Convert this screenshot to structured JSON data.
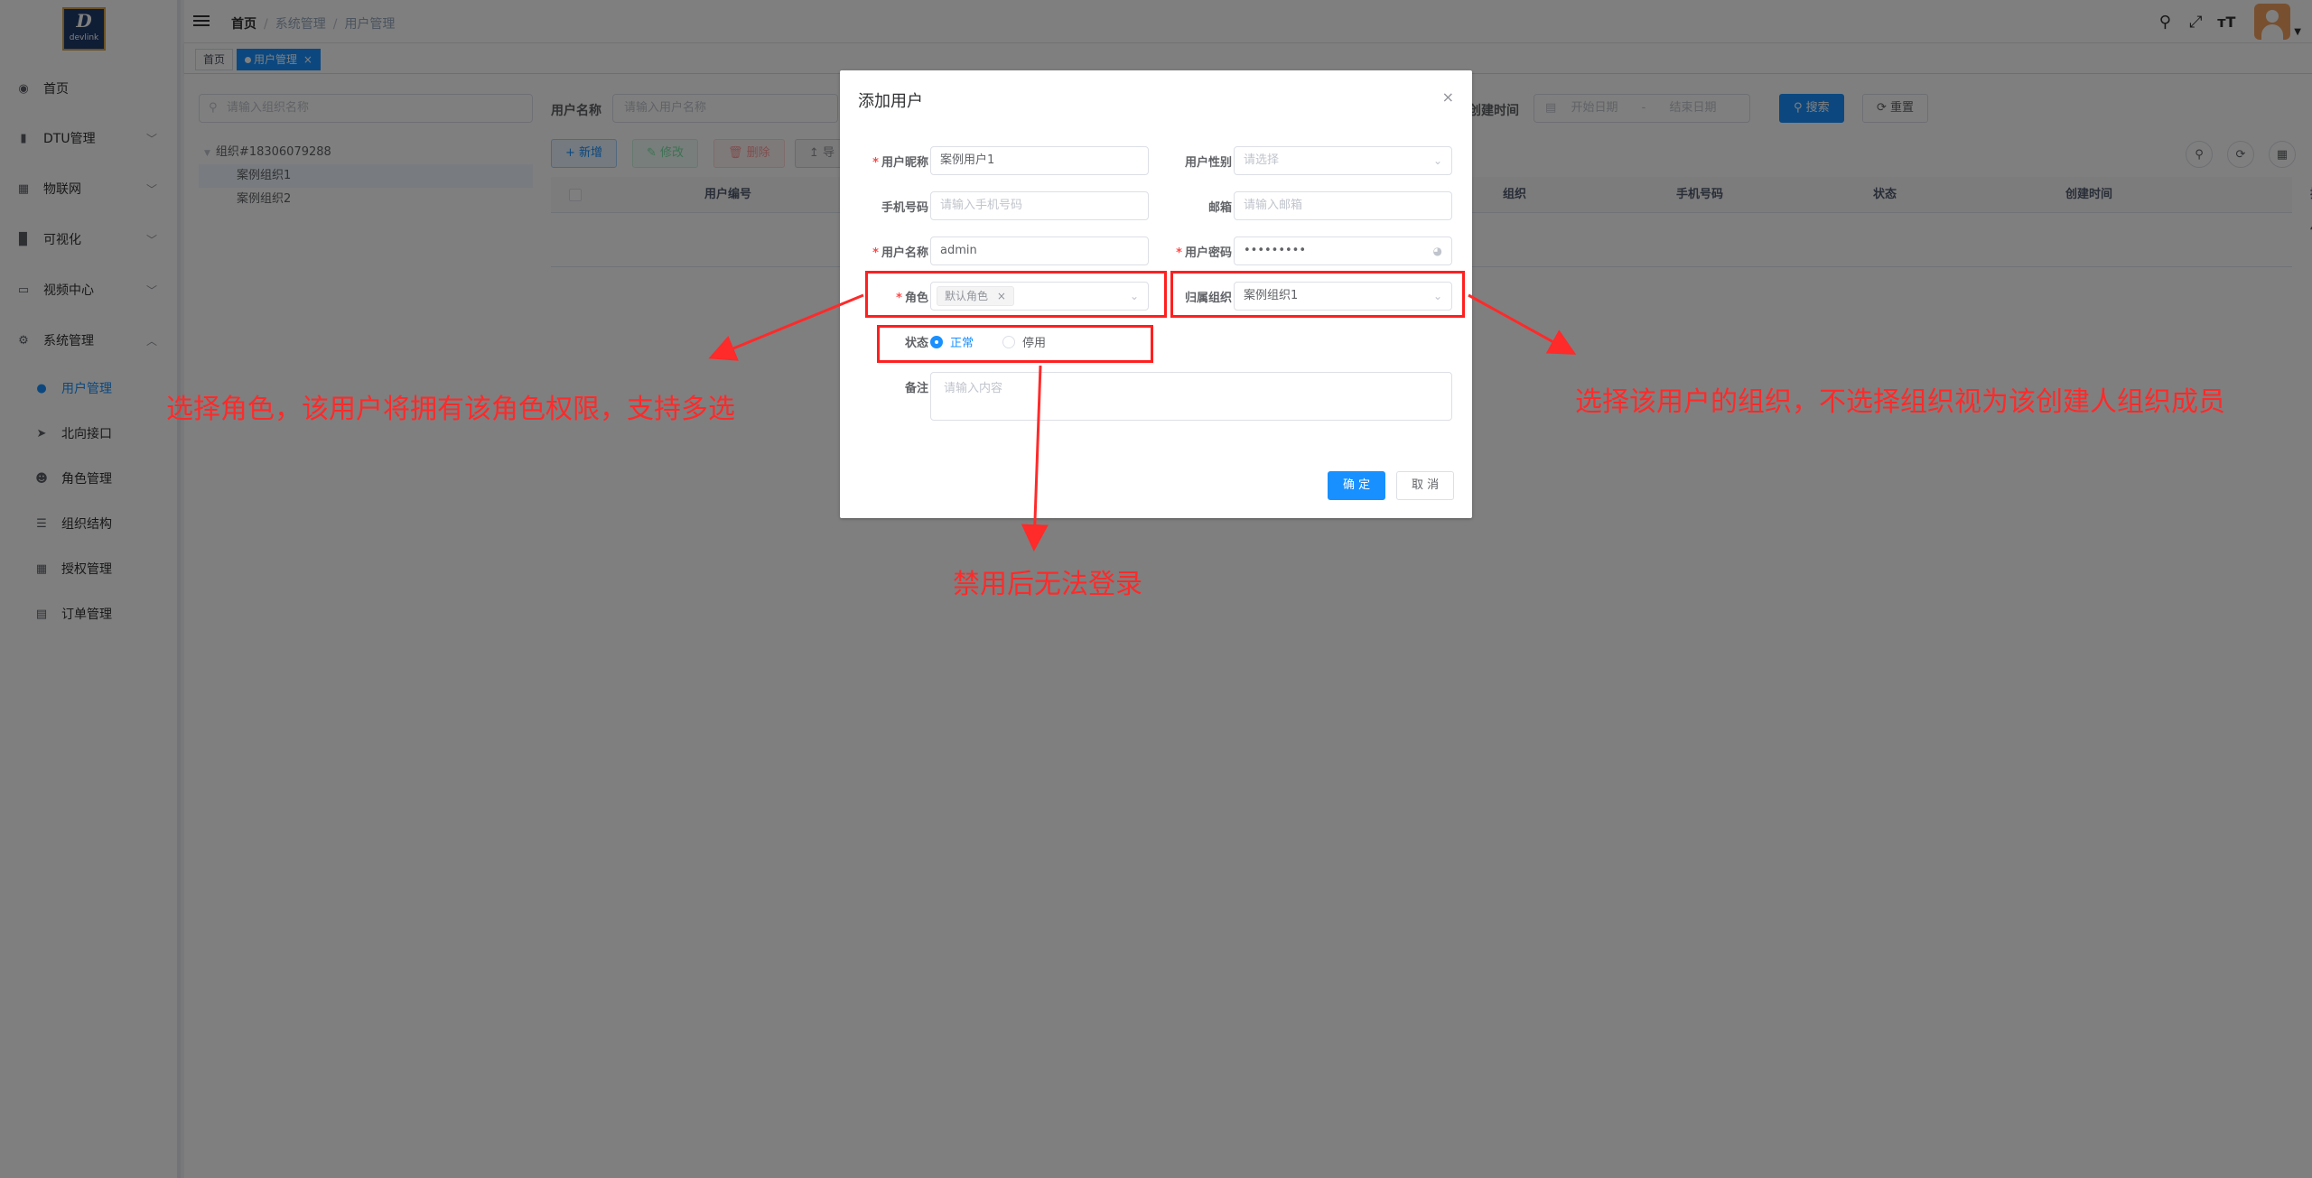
{
  "logo": {
    "line1": "D",
    "line2": "devlink"
  },
  "sidebar": {
    "items": [
      {
        "label": "首页",
        "icon": "dashboard-icon"
      },
      {
        "label": "DTU管理",
        "icon": "dtu-icon",
        "arrow": "﹀"
      },
      {
        "label": "物联网",
        "icon": "iot-icon",
        "arrow": "﹀"
      },
      {
        "label": "可视化",
        "icon": "chart-icon",
        "arrow": "﹀"
      },
      {
        "label": "视频中心",
        "icon": "monitor-icon",
        "arrow": "﹀"
      },
      {
        "label": "系统管理",
        "icon": "system-icon",
        "arrow": "︿"
      }
    ],
    "subitems": [
      {
        "label": "用户管理",
        "icon": "user-icon"
      },
      {
        "label": "北向接口",
        "icon": "send-icon"
      },
      {
        "label": "角色管理",
        "icon": "peoples-icon"
      },
      {
        "label": "组织结构",
        "icon": "tree-icon"
      },
      {
        "label": "授权管理",
        "icon": "grid-icon"
      },
      {
        "label": "订单管理",
        "icon": "order-icon"
      }
    ]
  },
  "topbar": {
    "breadcrumb": [
      "首页",
      "系统管理",
      "用户管理"
    ],
    "icons": [
      "search-icon",
      "fullscreen-icon",
      "font-size-icon"
    ]
  },
  "tags": {
    "home": "首页",
    "current": "用户管理",
    "close": "×"
  },
  "left_panel": {
    "search_placeholder": "请输入组织名称",
    "tree": {
      "root": "组织#18306079288",
      "children": [
        "案例组织1",
        "案例组织2"
      ]
    }
  },
  "filters": {
    "username_label": "用户名称",
    "username_placeholder": "请输入用户名称",
    "created_label": "创建时间",
    "start_placeholder": "开始日期",
    "range_sep": "-",
    "end_placeholder": "结束日期",
    "search_btn": "搜索",
    "reset_btn": "重置"
  },
  "toolbar": {
    "add": "新增",
    "edit": "修改",
    "delete": "删除",
    "export": "导"
  },
  "table": {
    "columns": [
      "用户编号",
      "组织",
      "手机号码",
      "状态",
      "创建时间",
      "操作"
    ]
  },
  "dialog": {
    "title": "添加用户",
    "close": "×",
    "fields": {
      "nickname_label": "用户昵称",
      "nickname_value": "案例用户1",
      "gender_label": "用户性别",
      "gender_placeholder": "请选择",
      "phone_label": "手机号码",
      "phone_placeholder": "请输入手机号码",
      "email_label": "邮箱",
      "email_placeholder": "请输入邮箱",
      "username_label": "用户名称",
      "username_value": "admin",
      "password_label": "用户密码",
      "password_value": "•••••••••",
      "role_label": "角色",
      "role_tag": "默认角色",
      "role_tag_close": "×",
      "org_label": "归属组织",
      "org_value": "案例组织1",
      "status_label": "状态",
      "status_on": "正常",
      "status_off": "停用",
      "remark_label": "备注",
      "remark_placeholder": "请输入内容"
    },
    "confirm": "确 定",
    "cancel": "取 消"
  },
  "annotations": {
    "role_note": "选择角色，该用户将拥有该角色权限，支持多选",
    "org_note": "选择该用户的组织，不选择组织视为该创建人组织成员",
    "status_note": "禁用后无法登录",
    "color": "#ff2a2a"
  }
}
